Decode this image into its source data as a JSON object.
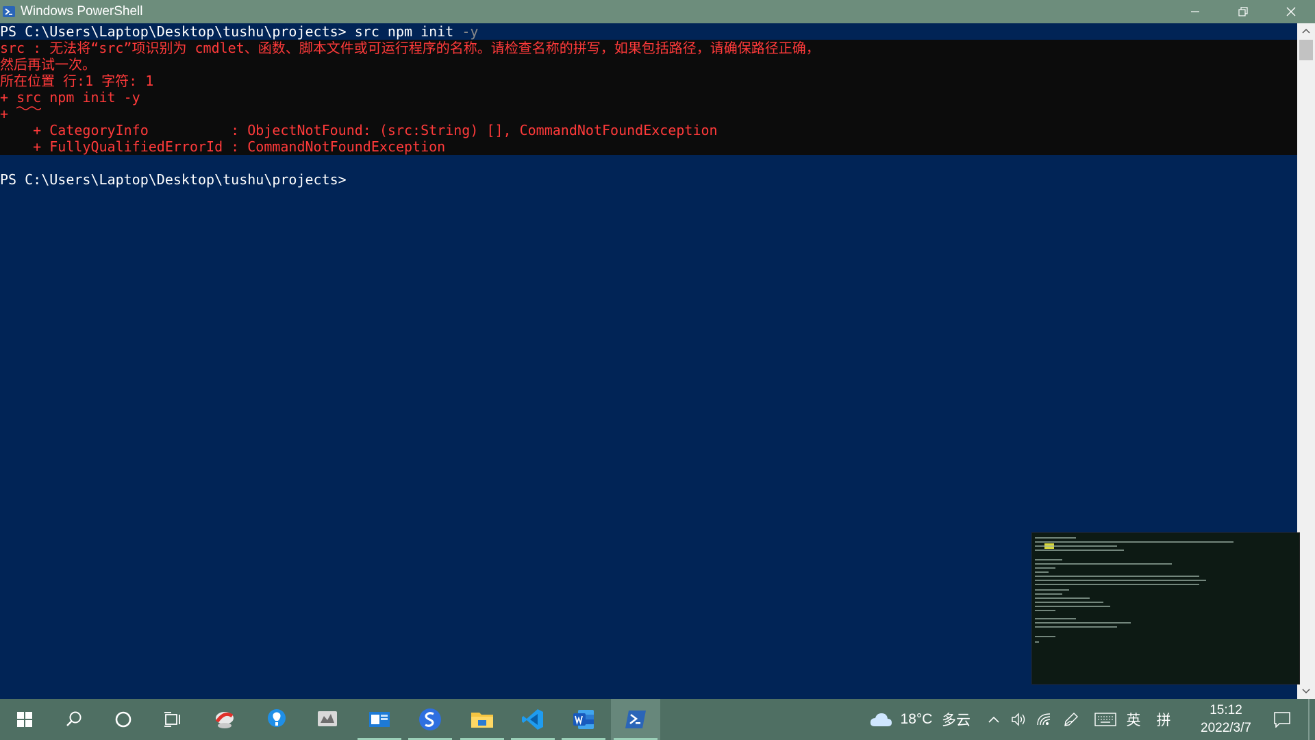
{
  "window": {
    "title": "Windows PowerShell",
    "minimize_icon": "minimize-icon",
    "restore_icon": "restore-icon",
    "close_icon": "close-icon"
  },
  "console": {
    "lines": [
      {
        "prompt": "PS C:\\Users\\Laptop\\Desktop\\tushu\\projects> ",
        "cmd": "src npm init ",
        "arg": "-y"
      },
      {
        "text": "src : 无法将“src”项识别为 cmdlet、函数、脚本文件或可运行程序的名称。请检查名称的拼写，如果包括路径，请确保路径正确，"
      },
      {
        "text": "然后再试一次。"
      },
      {
        "text": "所在位置 行:1 字符: 1"
      },
      {
        "text": "+ src npm init -y"
      },
      {
        "text": "+ "
      },
      {
        "text": "    + CategoryInfo          : ObjectNotFound: (src:String) [], CommandNotFoundException"
      },
      {
        "text": "    + FullyQualifiedErrorId : CommandNotFoundException"
      },
      {
        "text": ""
      },
      {
        "prompt": "PS C:\\Users\\Laptop\\Desktop\\tushu\\projects>"
      }
    ]
  },
  "colors": {
    "console_bg": "#012456",
    "error_bg": "#0c0c0c",
    "error_text": "#ff3a3a",
    "titlebar": "#6d8d7c",
    "taskbar": "#4f6f63"
  },
  "taskbar": {
    "icons": [
      "windows-start-icon",
      "search-icon",
      "cortana-icon",
      "task-view-icon",
      "app-icon-1",
      "tips-icon",
      "app-icon-2",
      "app-icon-3",
      "sogou-icon",
      "file-explorer-icon",
      "vscode-icon",
      "word-icon",
      "powershell-icon"
    ],
    "weather": {
      "temp": "18°C",
      "desc": "多云"
    },
    "ime": "英",
    "ime2": "拼",
    "time": "15:12",
    "date": "2022/3/7"
  }
}
